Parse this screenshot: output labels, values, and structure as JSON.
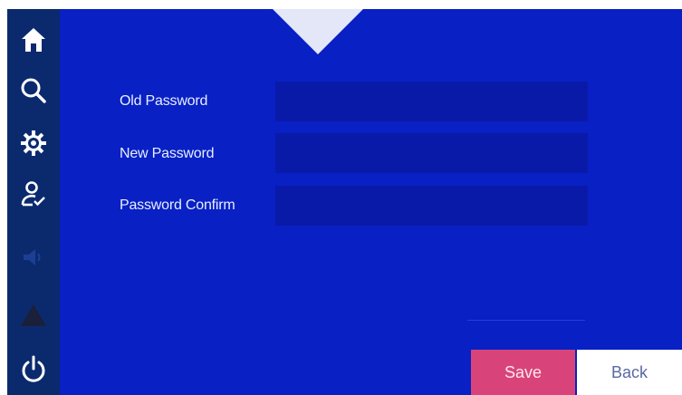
{
  "sidebar": {
    "items": [
      {
        "icon": "home-icon"
      },
      {
        "icon": "search-icon"
      },
      {
        "icon": "gear-icon"
      },
      {
        "icon": "user-check-icon"
      },
      {
        "icon": "speaker-icon"
      },
      {
        "icon": "warning-icon"
      },
      {
        "icon": "power-icon"
      }
    ]
  },
  "form": {
    "old_password": {
      "label": "Old Password",
      "value": ""
    },
    "new_password": {
      "label": "New Password",
      "value": ""
    },
    "confirm_password": {
      "label": "Password Confirm",
      "value": ""
    }
  },
  "buttons": {
    "save_label": "Save",
    "back_label": "Back"
  },
  "colors": {
    "background": "#0820c4",
    "sidebar": "#0b2a6e",
    "input": "#0a1aa8",
    "save": "#d8447a",
    "back": "#ffffff"
  }
}
